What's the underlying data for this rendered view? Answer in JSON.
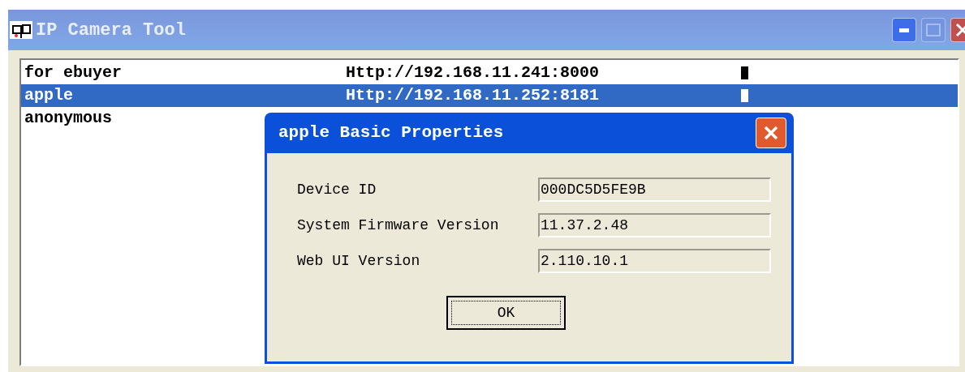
{
  "window": {
    "title": "IP Camera Tool",
    "buttons": [
      {
        "kind": "minimize",
        "disabled": false
      },
      {
        "kind": "maximize",
        "disabled": true
      },
      {
        "kind": "close",
        "disabled": false
      }
    ]
  },
  "cameras": [
    {
      "name": "for ebuyer",
      "url": "Http://192.168.11.241:8000",
      "selected": false
    },
    {
      "name": "apple",
      "url": "Http://192.168.11.252:8181",
      "selected": true
    },
    {
      "name": "anonymous",
      "selected": false
    }
  ],
  "dialog": {
    "title": "apple Basic Properties",
    "fields": [
      {
        "label": "Device ID",
        "value": "000DC5D5FE9B"
      },
      {
        "label": "System Firmware Version",
        "value": "11.37.2.48"
      },
      {
        "label": "Web UI Version",
        "value": "2.110.10.1"
      }
    ],
    "ok_button": "OK"
  }
}
